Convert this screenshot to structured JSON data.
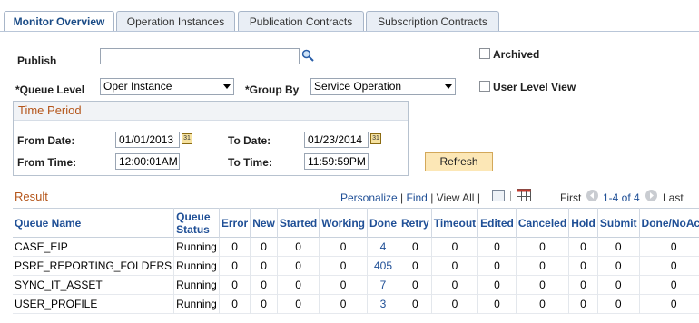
{
  "tabs": [
    {
      "label": "Monitor Overview",
      "active": true
    },
    {
      "label": "Operation Instances"
    },
    {
      "label": "Publication Contracts"
    },
    {
      "label": "Subscription Contracts"
    }
  ],
  "form": {
    "publish_label": "Publish",
    "publish_value": "",
    "archived_label": "Archived",
    "archived_checked": false,
    "queue_level_label": "*Queue Level",
    "queue_level_value": "Oper Instance",
    "group_by_label": "*Group By",
    "group_by_value": "Service Operation",
    "user_level_view_label": "User Level View",
    "user_level_view_checked": false
  },
  "time_period": {
    "title": "Time Period",
    "from_date_label": "From Date:",
    "from_date_value": "01/01/2013",
    "to_date_label": "To Date:",
    "to_date_value": "01/23/2014",
    "from_time_label": "From Time:",
    "from_time_value": "12:00:01AM",
    "to_time_label": "To Time:",
    "to_time_value": "11:59:59PM",
    "calendar_icon_text": "31"
  },
  "refresh_label": "Refresh",
  "result": {
    "title": "Result",
    "personalize": "Personalize",
    "find": "Find",
    "view_all": "View All",
    "first": "First",
    "range": "1-4 of 4",
    "last": "Last",
    "columns": [
      "Queue Name",
      "Queue Status",
      "Error",
      "New",
      "Started",
      "Working",
      "Done",
      "Retry",
      "Timeout",
      "Edited",
      "Canceled",
      "Hold",
      "Submit",
      "Done/NoAck"
    ],
    "rows": [
      [
        "CASE_EIP",
        "Running",
        "0",
        "0",
        "0",
        "0",
        "4",
        "0",
        "0",
        "0",
        "0",
        "0",
        "0",
        "0"
      ],
      [
        "PSRF_REPORTING_FOLDERS",
        "Running",
        "0",
        "0",
        "0",
        "0",
        "405",
        "0",
        "0",
        "0",
        "0",
        "0",
        "0",
        "0"
      ],
      [
        "SYNC_IT_ASSET",
        "Running",
        "0",
        "0",
        "0",
        "0",
        "7",
        "0",
        "0",
        "0",
        "0",
        "0",
        "0",
        "0"
      ],
      [
        "USER_PROFILE",
        "Running",
        "0",
        "0",
        "0",
        "0",
        "3",
        "0",
        "0",
        "0",
        "0",
        "0",
        "0",
        "0"
      ]
    ]
  },
  "colors": {
    "link": "#1f4f96",
    "section_title": "#b5561b",
    "button_bg": "#fce7b6"
  }
}
